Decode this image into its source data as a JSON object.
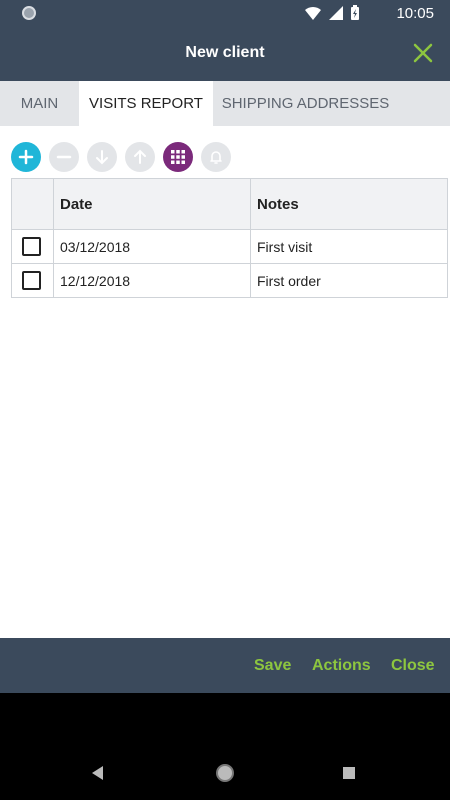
{
  "status_bar": {
    "time": "10:05"
  },
  "header": {
    "title": "New client"
  },
  "tabs": [
    {
      "label": "MAIN",
      "active": false
    },
    {
      "label": "VISITS REPORT",
      "active": true
    },
    {
      "label": "SHIPPING ADDRESSES",
      "active": false
    }
  ],
  "toolbar": {
    "buttons": [
      "add-icon",
      "minus-icon",
      "arrow-down-icon",
      "arrow-up-icon",
      "grid-icon",
      "bell-icon"
    ]
  },
  "table": {
    "columns": [
      "Date",
      "Notes"
    ],
    "rows": [
      {
        "date": "03/12/2018",
        "notes": "First visit"
      },
      {
        "date": "12/12/2018",
        "notes": "First order"
      }
    ]
  },
  "footer": {
    "save": "Save",
    "actions": "Actions",
    "close": "Close"
  },
  "colors": {
    "header_bg": "#3b4a5c",
    "accent_green": "#8dc63f",
    "add_cyan": "#20b6d8",
    "grid_purple": "#7b2a7b"
  }
}
